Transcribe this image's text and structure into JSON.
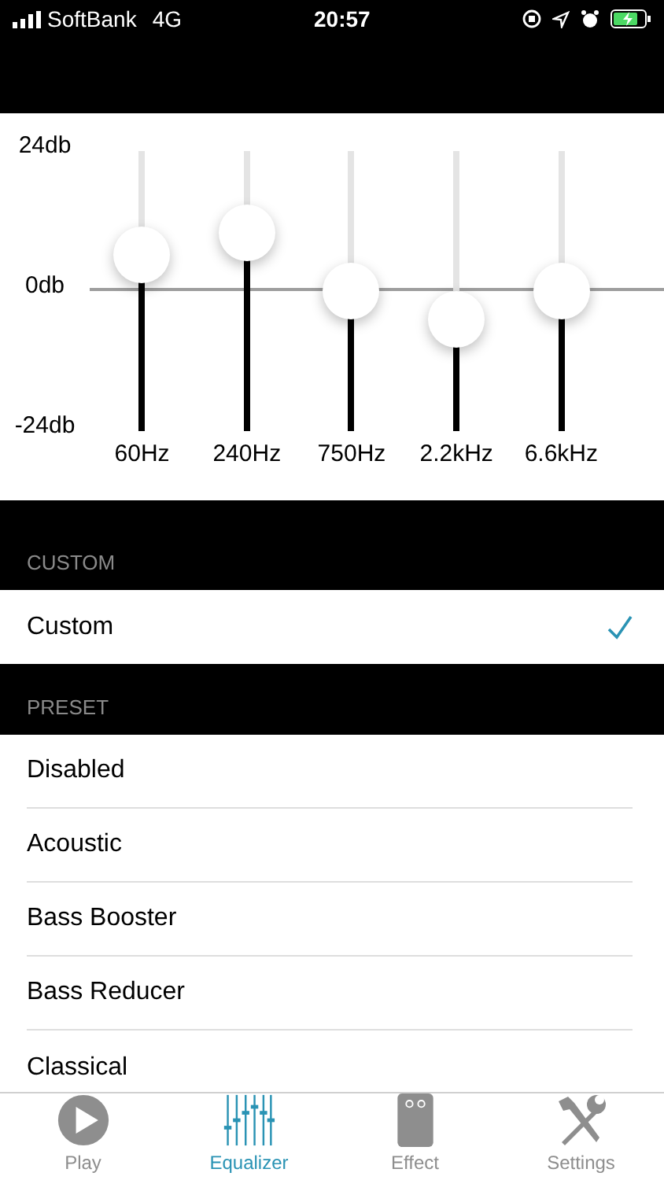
{
  "status_bar": {
    "carrier": "SoftBank",
    "network": "4G",
    "time": "20:57"
  },
  "equalizer": {
    "scale": [
      "24db",
      "0db",
      "-24db"
    ],
    "bands": [
      {
        "label": "60Hz",
        "level": 0.63
      },
      {
        "label": "240Hz",
        "level": 0.71
      },
      {
        "label": "750Hz",
        "level": 0.5
      },
      {
        "label": "2.2kHz",
        "level": 0.4
      },
      {
        "label": "6.6kHz",
        "level": 0.5
      }
    ]
  },
  "sections": [
    {
      "header": "CUSTOM",
      "items": [
        {
          "label": "Custom",
          "checked": true
        }
      ]
    },
    {
      "header": "PRESET",
      "items": [
        {
          "label": "Disabled",
          "checked": false
        },
        {
          "label": "Acoustic",
          "checked": false
        },
        {
          "label": "Bass Booster",
          "checked": false
        },
        {
          "label": "Bass Reducer",
          "checked": false
        },
        {
          "label": "Classical",
          "checked": false
        }
      ]
    }
  ],
  "tabs": [
    {
      "kind": "play",
      "label": "Play",
      "selected": false
    },
    {
      "kind": "equalizer",
      "label": "Equalizer",
      "selected": true
    },
    {
      "kind": "effect",
      "label": "Effect",
      "selected": false
    },
    {
      "kind": "settings",
      "label": "Settings",
      "selected": false
    }
  ]
}
